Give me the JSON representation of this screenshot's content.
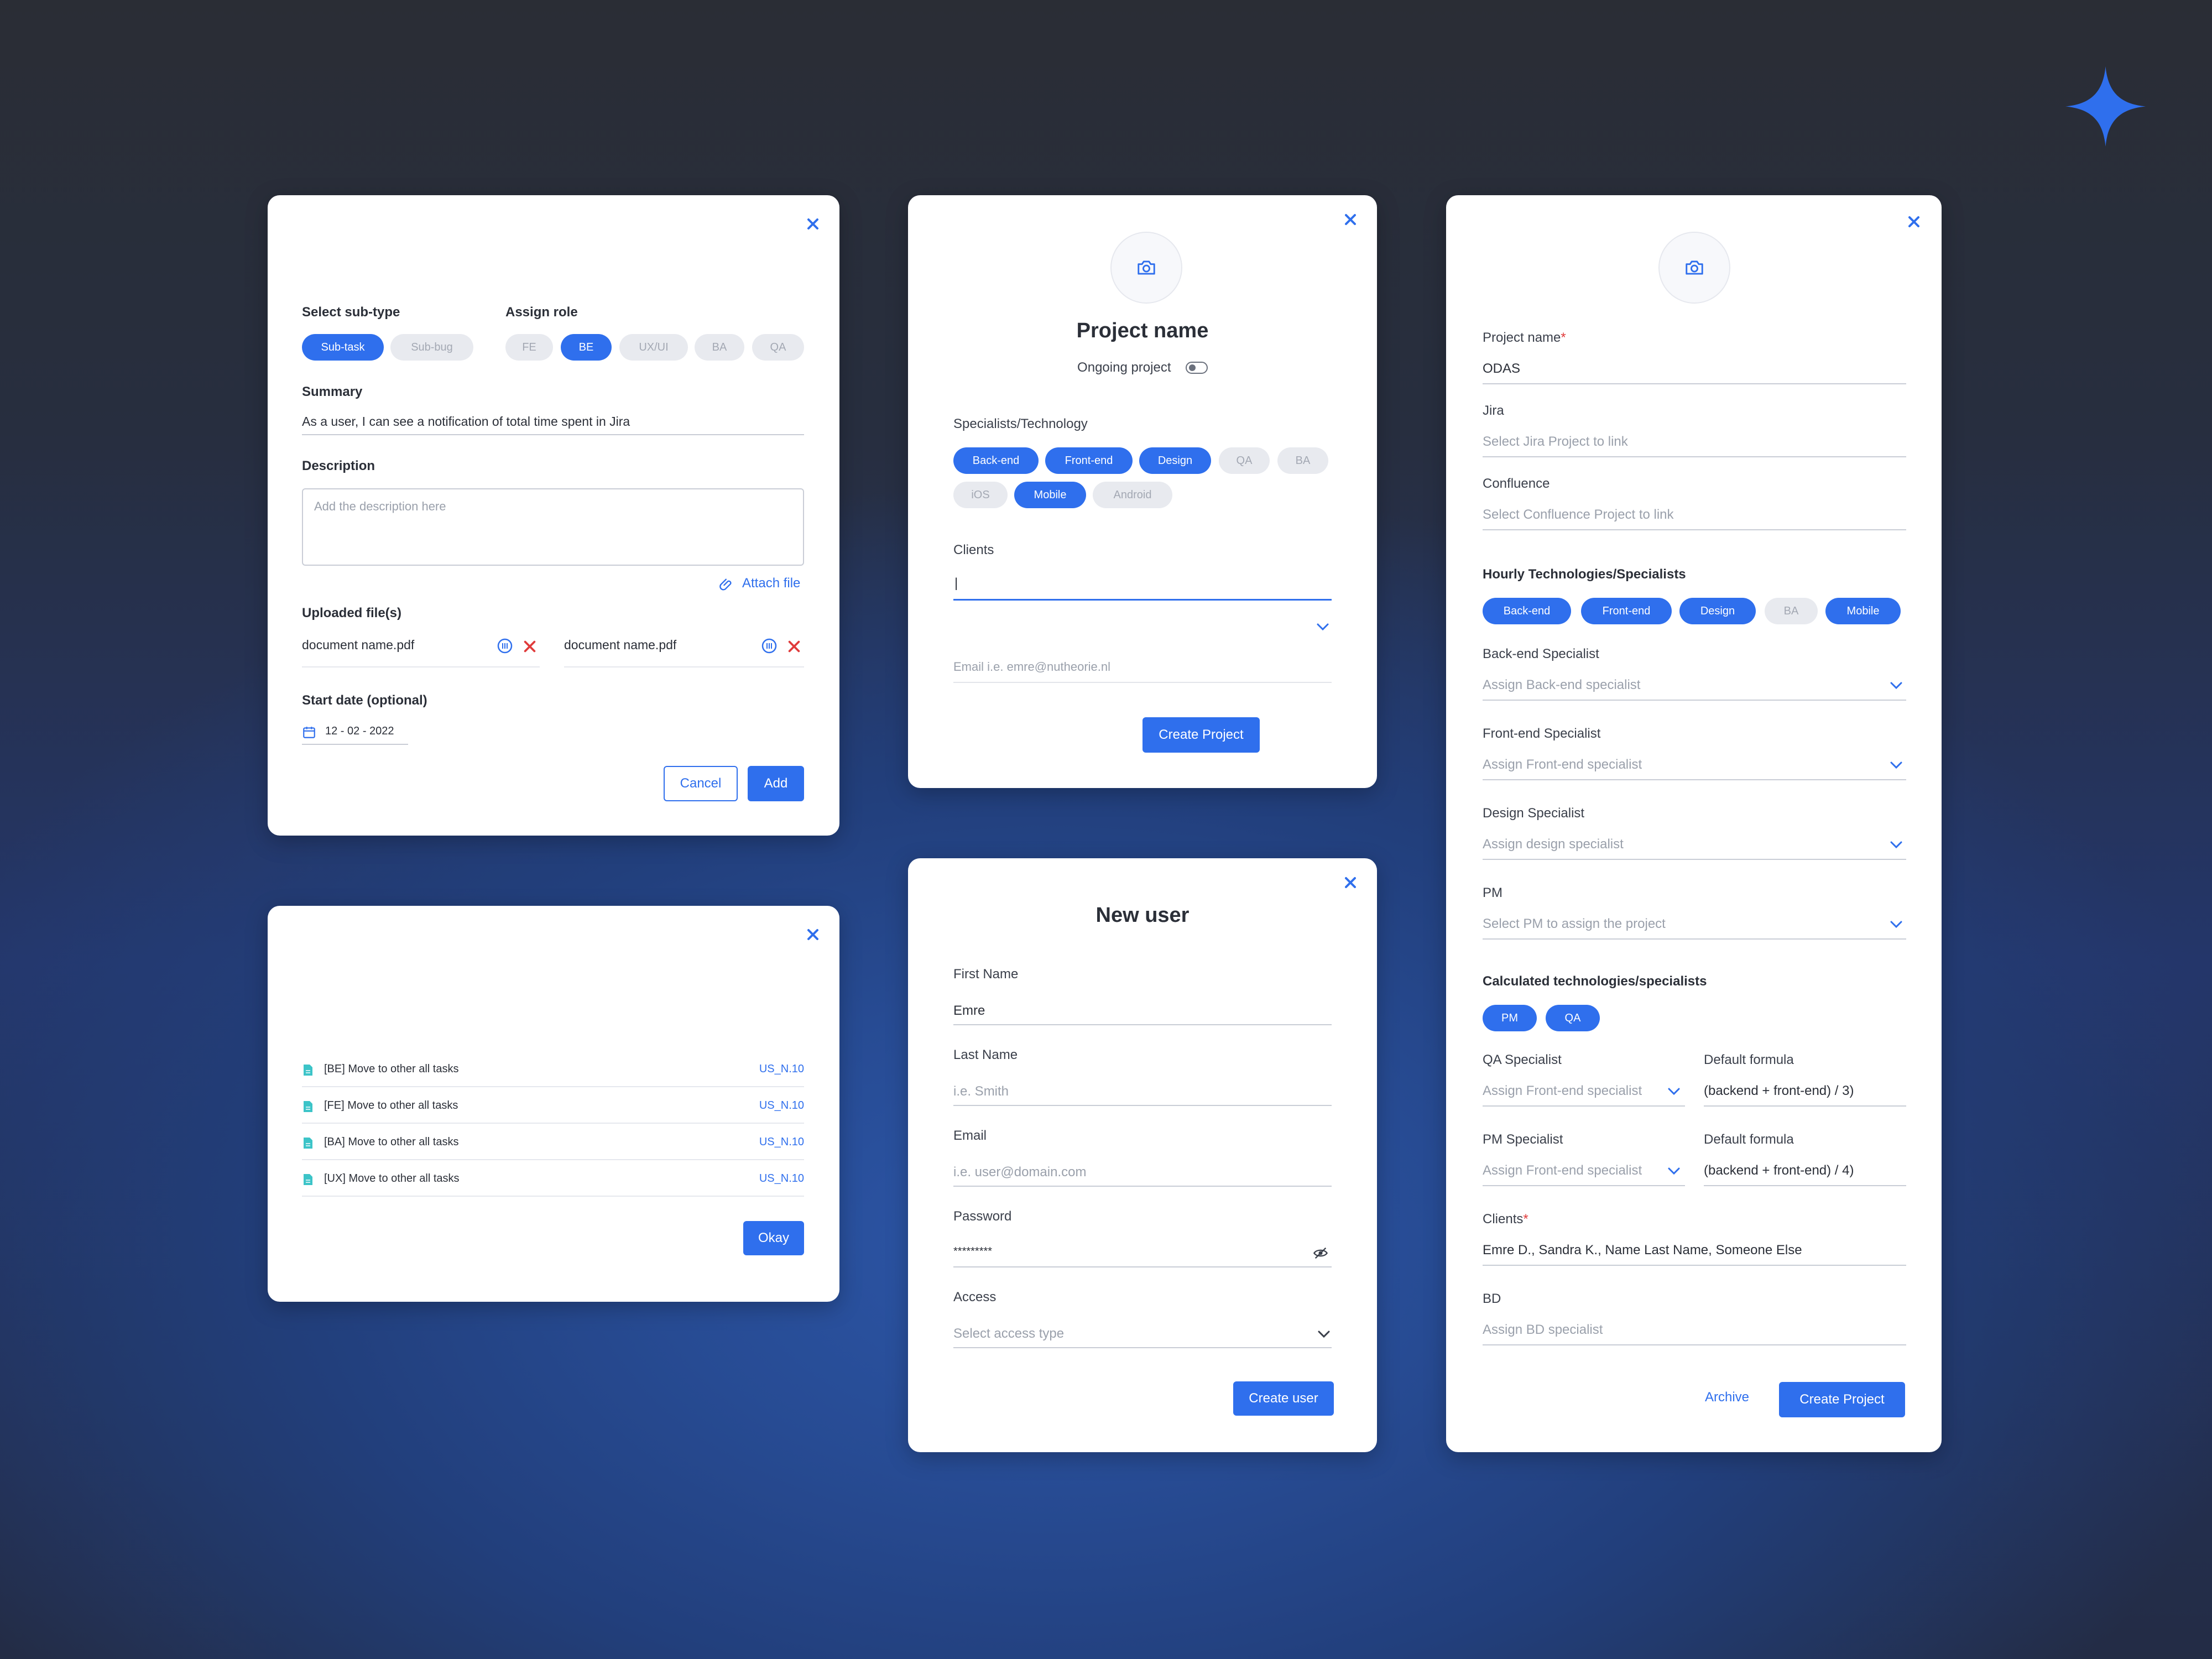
{
  "colors": {
    "accent": "#2f6fed",
    "danger": "#e03b3b",
    "chip_off": "#e8eaef",
    "bg_dark": "#2a2d35",
    "bg_blue": "#24408a"
  },
  "subtask_modal": {
    "subtype_label": "Select sub-type",
    "subtypes": [
      {
        "label": "Sub-task",
        "selected": true
      },
      {
        "label": "Sub-bug",
        "selected": false
      }
    ],
    "role_label": "Assign role",
    "roles": [
      {
        "label": "FE",
        "selected": false
      },
      {
        "label": "BE",
        "selected": true
      },
      {
        "label": "UX/UI",
        "selected": false
      },
      {
        "label": "BA",
        "selected": false
      },
      {
        "label": "QA",
        "selected": false
      }
    ],
    "summary_label": "Summary",
    "summary_value": "As a user, I can see a notification of total time spent in Jira",
    "description_label": "Description",
    "description_placeholder": "Add the description here",
    "attach_label": "Attach file",
    "uploaded_label": "Uploaded file(s)",
    "files": [
      "document name.pdf",
      "document name.pdf"
    ],
    "start_date_label": "Start date (optional)",
    "start_date_value": "12 - 02 - 2022",
    "cancel_label": "Cancel",
    "add_label": "Add"
  },
  "tasks_modal": {
    "rows": [
      {
        "tag": "[BE]",
        "text": "Move to other all tasks",
        "id": "US_N.10"
      },
      {
        "tag": "[FE]",
        "text": "Move to other all tasks",
        "id": "US_N.10"
      },
      {
        "tag": "[BA]",
        "text": "Move to other all tasks",
        "id": "US_N.10"
      },
      {
        "tag": "[UX]",
        "text": "Move to other all tasks",
        "id": "US_N.10"
      }
    ],
    "okay_label": "Okay"
  },
  "project_modal": {
    "title": "Project name",
    "ongoing_label": "Ongoing project",
    "ongoing_on": false,
    "specialists_label": "Specialists/Technology",
    "techs": [
      {
        "label": "Back-end",
        "selected": true
      },
      {
        "label": "Front-end",
        "selected": true
      },
      {
        "label": "Design",
        "selected": true
      },
      {
        "label": "QA",
        "selected": false
      },
      {
        "label": "BA",
        "selected": false
      },
      {
        "label": "iOS",
        "selected": false
      },
      {
        "label": "Mobile",
        "selected": true
      },
      {
        "label": "Android",
        "selected": false
      }
    ],
    "clients_label": "Clients",
    "clients_value": "|",
    "email_placeholder": "Email i.e. emre@nutheorie.nl",
    "create_label": "Create Project"
  },
  "new_user_modal": {
    "title": "New user",
    "first_name_label": "First Name",
    "first_name_value": "Emre",
    "last_name_label": "Last Name",
    "last_name_placeholder": "i.e. Smith",
    "email_label": "Email",
    "email_placeholder": "i.e. user@domain.com",
    "password_label": "Password",
    "password_value": "*********",
    "access_label": "Access",
    "access_placeholder": "Select access type",
    "create_label": "Create user"
  },
  "odas_modal": {
    "project_name_label": "Project name",
    "project_name_value": "ODAS",
    "jira_label": "Jira",
    "jira_placeholder": "Select Jira Project to link",
    "confluence_label": "Confluence",
    "confluence_placeholder": "Select Confluence Project to link",
    "hourly_label": "Hourly Technologies/Specialists",
    "hourly_chips": [
      {
        "label": "Back-end",
        "selected": true
      },
      {
        "label": "Front-end",
        "selected": true
      },
      {
        "label": "Design",
        "selected": true
      },
      {
        "label": "BA",
        "selected": false
      },
      {
        "label": "Mobile",
        "selected": true
      }
    ],
    "backend_label": "Back-end Specialist",
    "backend_placeholder": "Assign Back-end specialist",
    "frontend_label": "Front-end Specialist",
    "frontend_placeholder": "Assign Front-end specialist",
    "design_label": "Design Specialist",
    "design_placeholder": "Assign design specialist",
    "pm_label": "PM",
    "pm_placeholder": "Select PM to assign the project",
    "calculated_label": "Calculated technologies/specialists",
    "calculated_chips": [
      {
        "label": "PM",
        "selected": true
      },
      {
        "label": "QA",
        "selected": true
      }
    ],
    "qa_label": "QA Specialist",
    "qa_placeholder": "Assign Front-end specialist",
    "qa_formula_label": "Default formula",
    "qa_formula_value": "(backend + front-end) / 3)",
    "pm_spec_label": "PM Specialist",
    "pm_spec_placeholder": "Assign Front-end specialist",
    "pm_formula_label": "Default formula",
    "pm_formula_value": "(backend + front-end) / 4)",
    "clients_label": "Clients",
    "clients_value": "Emre D., Sandra K., Name Last Name, Someone Else",
    "bd_label": "BD",
    "bd_placeholder": "Assign BD specialist",
    "archive_label": "Archive",
    "create_label": "Create Project"
  }
}
